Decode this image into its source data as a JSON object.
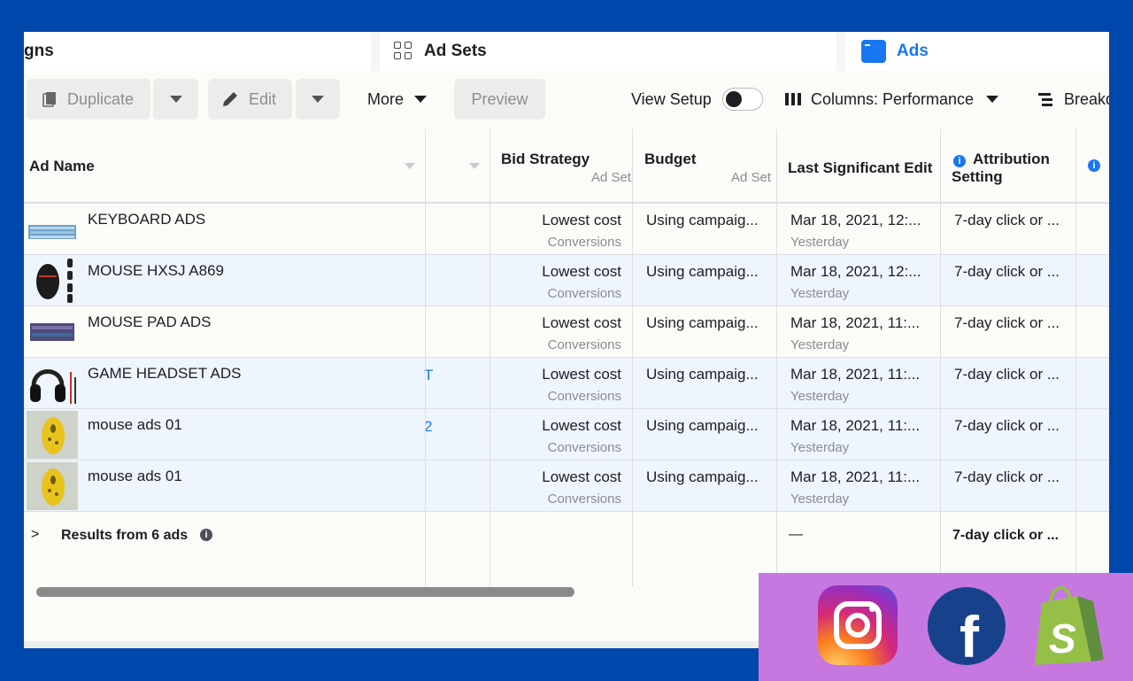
{
  "tabs": {
    "campaigns": "gns",
    "ad_sets": "Ad Sets",
    "ads": "Ads"
  },
  "toolbar": {
    "duplicate": "Duplicate",
    "edit": "Edit",
    "more": "More",
    "preview": "Preview",
    "view_setup": "View Setup",
    "columns": "Columns: Performance",
    "breakdown": "Breakd"
  },
  "columns": {
    "ad_name": "Ad Name",
    "bid_strategy": "Bid Strategy",
    "bid_strategy_sub": "Ad Set",
    "budget": "Budget",
    "budget_sub": "Ad Set",
    "last_edit": "Last Significant Edit",
    "attribution_line1": "Attribution",
    "attribution_line2": "Setting"
  },
  "rows": [
    {
      "name": "KEYBOARD ADS",
      "stub": "",
      "bid": "Lowest cost",
      "bid_sub": "Conversions",
      "budget": "Using campaig...",
      "edit": "Mar 18, 2021, 12:...",
      "edit_sub": "Yesterday",
      "attribution": "7-day click or ...",
      "thumb": "keyboard-thumbnail"
    },
    {
      "name": "MOUSE HXSJ A869",
      "stub": "",
      "bid": "Lowest cost",
      "bid_sub": "Conversions",
      "budget": "Using campaig...",
      "edit": "Mar 18, 2021, 12:...",
      "edit_sub": "Yesterday",
      "attribution": "7-day click or ...",
      "thumb": "mouse-thumbnail"
    },
    {
      "name": "MOUSE PAD ADS",
      "stub": "",
      "bid": "Lowest cost",
      "bid_sub": "Conversions",
      "budget": "Using campaig...",
      "edit": "Mar 18, 2021, 11:...",
      "edit_sub": "Yesterday",
      "attribution": "7-day click or ...",
      "thumb": "mousepad-thumbnail"
    },
    {
      "name": "GAME HEADSET ADS",
      "stub": "T",
      "bid": "Lowest cost",
      "bid_sub": "Conversions",
      "budget": "Using campaig...",
      "edit": "Mar 18, 2021, 11:...",
      "edit_sub": "Yesterday",
      "attribution": "7-day click or ...",
      "thumb": "headset-thumbnail"
    },
    {
      "name": "mouse ads 01",
      "stub": "2",
      "bid": "Lowest cost",
      "bid_sub": "Conversions",
      "budget": "Using campaig...",
      "edit": "Mar 18, 2021, 11:...",
      "edit_sub": "Yesterday",
      "attribution": "7-day click or ...",
      "thumb": "yellow-mouse-thumbnail"
    },
    {
      "name": "mouse ads 01",
      "stub": "",
      "bid": "Lowest cost",
      "bid_sub": "Conversions",
      "budget": "Using campaig...",
      "edit": "Mar 18, 2021, 11:...",
      "edit_sub": "Yesterday",
      "attribution": "7-day click or ...",
      "thumb": "yellow-mouse-thumbnail"
    }
  ],
  "summary": {
    "label": "Results from 6 ads",
    "last_edit": "—",
    "attribution": "7-day click or ..."
  },
  "colors": {
    "background": "#0047ab",
    "accent": "#1877f2",
    "overlay": "#c678e0"
  }
}
